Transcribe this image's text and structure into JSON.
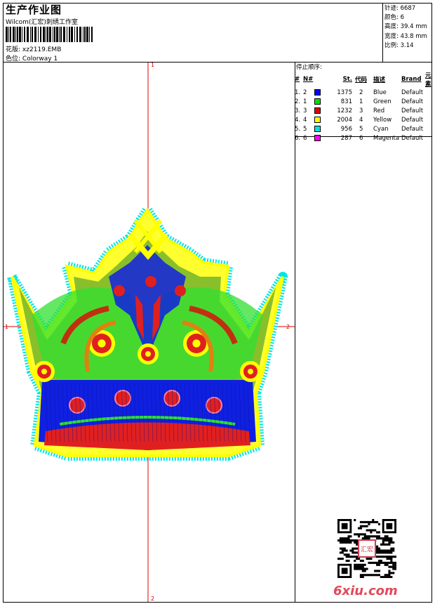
{
  "header": {
    "title": "生产作业图",
    "studio": "Wilcom(汇宏)刺绣工作室",
    "pattern_label": "花版:",
    "pattern_file": "xz2119.EMB",
    "colorway_label": "色位:",
    "colorway": "Colorway 1"
  },
  "stats": {
    "stitches_label": "针迹:",
    "stitches": "6687",
    "colors_label": "颜色:",
    "colors": "6",
    "height_label": "高度:",
    "height": "39.4 mm",
    "width_label": "宽度:",
    "width": "43.8 mm",
    "ratio_label": "比例:",
    "ratio": "3.14"
  },
  "color_table": {
    "title": "停止顺序:",
    "headers": [
      "#",
      "N#",
      "St.",
      "代码",
      "描述",
      "Brand",
      "元素"
    ],
    "rows": [
      {
        "idx": "1.",
        "n": "2",
        "st": "1375",
        "code": "2",
        "desc": "Blue",
        "brand": "Default",
        "color": "#0000ff"
      },
      {
        "idx": "2.",
        "n": "1",
        "st": "831",
        "code": "1",
        "desc": "Green",
        "brand": "Default",
        "color": "#00e000"
      },
      {
        "idx": "3.",
        "n": "3",
        "st": "1232",
        "code": "3",
        "desc": "Red",
        "brand": "Default",
        "color": "#e00000"
      },
      {
        "idx": "4.",
        "n": "4",
        "st": "2004",
        "code": "4",
        "desc": "Yellow",
        "brand": "Default",
        "color": "#ffff00"
      },
      {
        "idx": "5.",
        "n": "5",
        "st": "956",
        "code": "5",
        "desc": "Cyan",
        "brand": "Default",
        "color": "#00e0e0"
      },
      {
        "idx": "6.",
        "n": "6",
        "st": "287",
        "code": "6",
        "desc": "Magenta",
        "brand": "Default",
        "color": "#ff00ff"
      }
    ]
  },
  "axes": {
    "top": "1",
    "bottom": "2",
    "left": "1",
    "right": "2"
  },
  "watermark": "6xiu.com",
  "seal_text": "汇宏"
}
